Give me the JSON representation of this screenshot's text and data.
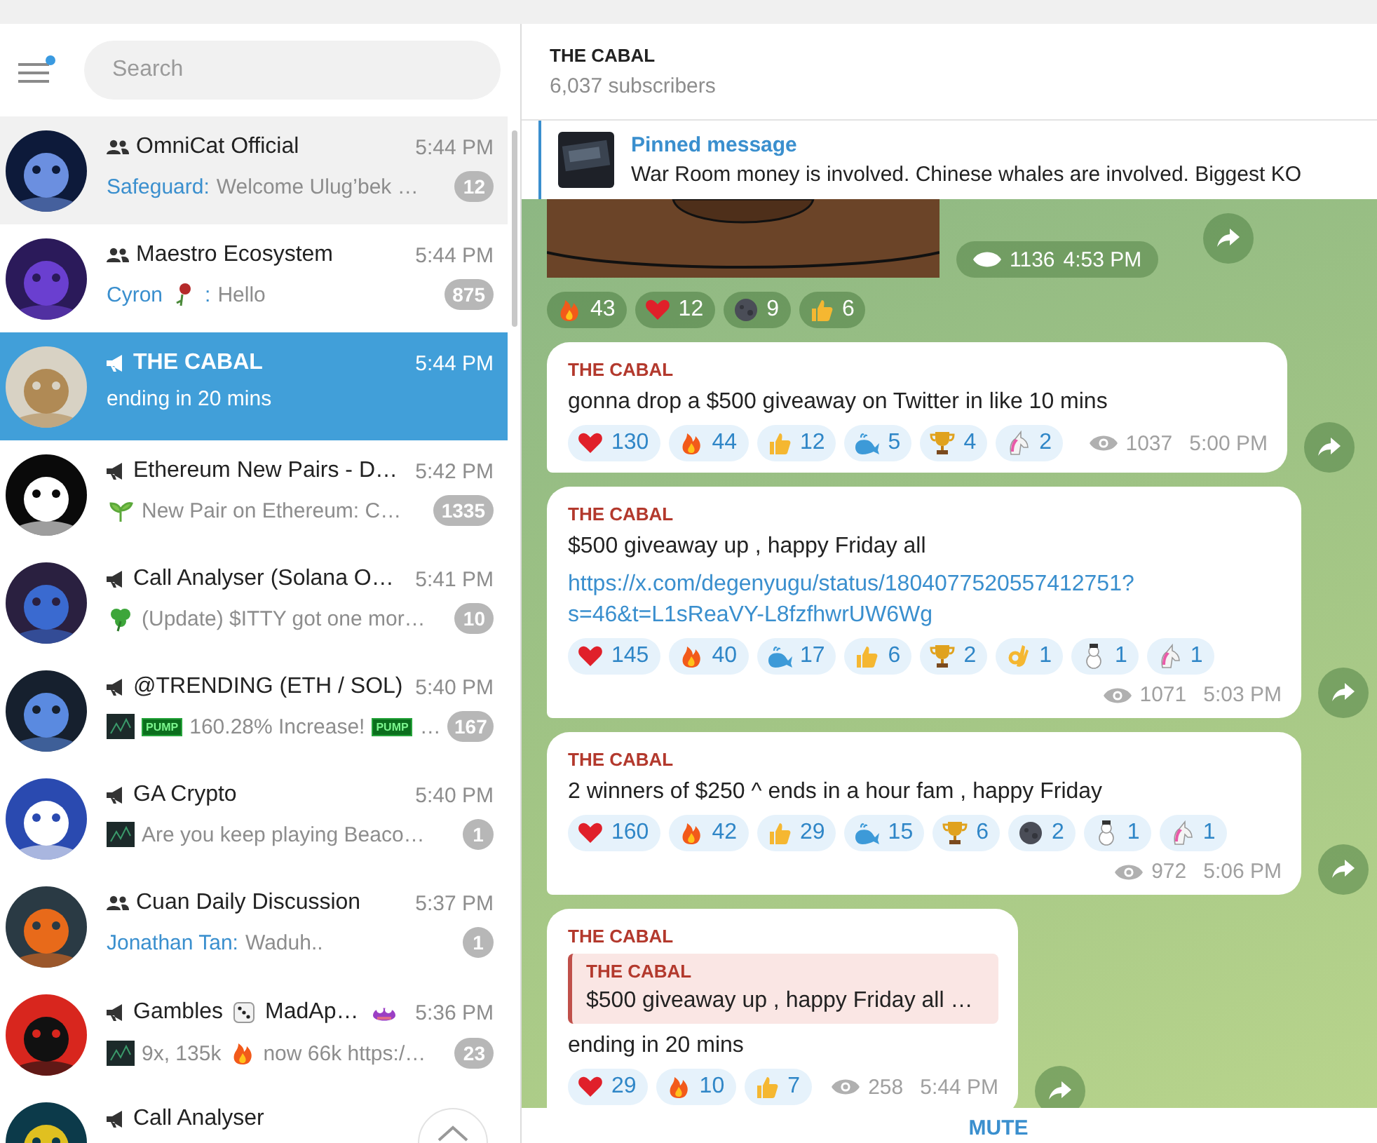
{
  "sidebar": {
    "search": {
      "placeholder": "Search"
    },
    "menu_unread": true,
    "chats": [
      {
        "kind": "group",
        "title": "OmniCat Official",
        "time": "5:44 PM",
        "preview": [
          {
            "kind": "sender",
            "text": "Safeguard:"
          },
          {
            "kind": "text",
            "text": "Welcome Ulug’bek …"
          }
        ],
        "badge": "12",
        "selected": false,
        "hovered": true
      },
      {
        "kind": "group",
        "title": "Maestro Ecosystem",
        "time": "5:44 PM",
        "preview": [
          {
            "kind": "sender",
            "text": "Cyron"
          },
          {
            "kind": "rose"
          },
          {
            "kind": "sender",
            "text": ":"
          },
          {
            "kind": "text",
            "text": "Hello"
          }
        ],
        "badge": "875",
        "selected": false,
        "hovered": false
      },
      {
        "kind": "channel",
        "title": "THE CABAL",
        "time": "5:44 PM",
        "preview": [
          {
            "kind": "text",
            "text": "ending in 20 mins"
          }
        ],
        "selected": true,
        "hovered": false
      },
      {
        "kind": "channel",
        "title": "Ethereum New Pairs - D…",
        "time": "5:42 PM",
        "preview": [
          {
            "kind": "sprout"
          },
          {
            "kind": "text",
            "text": "New Pair on Ethereum: C…"
          }
        ],
        "badge": "1335",
        "selected": false,
        "hovered": false
      },
      {
        "kind": "channel",
        "title": "Call Analyser (Solana O…",
        "time": "5:41 PM",
        "preview": [
          {
            "kind": "clover"
          },
          {
            "kind": "text",
            "text": "(Update) $ITTY got one mor…"
          }
        ],
        "badge": "10",
        "selected": false,
        "hovered": false
      },
      {
        "kind": "channel",
        "title": "@TRENDING (ETH / SOL)",
        "time": "5:40 PM",
        "preview": [
          {
            "kind": "thumb"
          },
          {
            "kind": "tag",
            "text": "PUMP"
          },
          {
            "kind": "text",
            "text": "160.28% Increase!"
          },
          {
            "kind": "tag",
            "text": "PUMP"
          },
          {
            "kind": "text",
            "text": "…"
          }
        ],
        "badge": "167",
        "selected": false,
        "hovered": false
      },
      {
        "kind": "channel",
        "title": "GA Crypto",
        "time": "5:40 PM",
        "preview": [
          {
            "kind": "thumb"
          },
          {
            "kind": "text",
            "text": "Are you keep playing Beaco…"
          }
        ],
        "badge": "1",
        "selected": false,
        "hovered": false
      },
      {
        "kind": "group",
        "title": "Cuan Daily Discussion",
        "time": "5:37 PM",
        "preview": [
          {
            "kind": "sender",
            "text": "Jonathan Tan:"
          },
          {
            "kind": "text",
            "text": "Waduh.."
          }
        ],
        "badge": "1",
        "selected": false,
        "hovered": false
      },
      {
        "kind": "channel",
        "title": "Gambles",
        "title_tail": [
          {
            "kind": "dice"
          },
          {
            "kind": "text",
            "text": "MadAp…"
          },
          {
            "kind": "frog"
          }
        ],
        "time": "5:36 PM",
        "preview": [
          {
            "kind": "thumb"
          },
          {
            "kind": "text",
            "text": "9x, 135k"
          },
          {
            "kind": "fire"
          },
          {
            "kind": "text",
            "text": "now 66k https:/…"
          }
        ],
        "badge": "23",
        "selected": false,
        "hovered": false
      },
      {
        "kind": "channel",
        "title": "Call Analyser",
        "selected": false,
        "hovered": false
      }
    ]
  },
  "channel": {
    "title": "THE CABAL",
    "subtitle": "6,037 subscribers",
    "pinned": {
      "label": "Pinned message",
      "text": "War Room money is involved.  Chinese whales are involved.  Biggest KO"
    },
    "top_post": {
      "views": "1136",
      "time": "4:53 PM",
      "reactions": [
        {
          "kind": "fire",
          "count": "43"
        },
        {
          "kind": "heart",
          "count": "12"
        },
        {
          "kind": "moon",
          "count": "9"
        },
        {
          "kind": "thumbs",
          "count": "6"
        }
      ]
    },
    "posts": [
      {
        "author": "THE CABAL",
        "text": "gonna drop a $500 giveaway on Twitter in like 10 mins",
        "views": "1037",
        "time": "5:00 PM",
        "reactions": [
          {
            "kind": "heart",
            "count": "130"
          },
          {
            "kind": "fire",
            "count": "44"
          },
          {
            "kind": "thumbs",
            "count": "12"
          },
          {
            "kind": "whale",
            "count": "5"
          },
          {
            "kind": "trophy",
            "count": "4"
          },
          {
            "kind": "unicorn",
            "count": "2"
          }
        ]
      },
      {
        "author": "THE CABAL",
        "text": "$500 giveaway up , happy Friday all",
        "link": "https://x.com/degenyugu/status/1804077520557412751?s=46&t=L1sReaVY-L8fzfhwrUW6Wg",
        "views": "1071",
        "time": "5:03 PM",
        "reactions": [
          {
            "kind": "heart",
            "count": "145"
          },
          {
            "kind": "fire",
            "count": "40"
          },
          {
            "kind": "whale",
            "count": "17"
          },
          {
            "kind": "thumbs",
            "count": "6"
          },
          {
            "kind": "trophy",
            "count": "2"
          },
          {
            "kind": "ok",
            "count": "1"
          },
          {
            "kind": "snowman",
            "count": "1"
          },
          {
            "kind": "unicorn",
            "count": "1"
          }
        ]
      },
      {
        "author": "THE CABAL",
        "text": "2 winners of $250 ^ ends in a hour fam , happy Friday",
        "views": "972",
        "time": "5:06 PM",
        "reactions": [
          {
            "kind": "heart",
            "count": "160"
          },
          {
            "kind": "fire",
            "count": "42"
          },
          {
            "kind": "thumbs",
            "count": "29"
          },
          {
            "kind": "whale",
            "count": "15"
          },
          {
            "kind": "trophy",
            "count": "6"
          },
          {
            "kind": "moon",
            "count": "2"
          },
          {
            "kind": "snowman",
            "count": "1"
          },
          {
            "kind": "unicorn",
            "count": "1"
          }
        ]
      },
      {
        "author": "THE CABAL",
        "quote": {
          "author": "THE CABAL",
          "text": "$500 giveaway up , happy Friday all …"
        },
        "text": "ending in 20 mins",
        "views": "258",
        "time": "5:44 PM",
        "reactions": [
          {
            "kind": "heart",
            "count": "29"
          },
          {
            "kind": "fire",
            "count": "10"
          },
          {
            "kind": "thumbs",
            "count": "7"
          }
        ]
      }
    ],
    "action": "MUTE"
  }
}
